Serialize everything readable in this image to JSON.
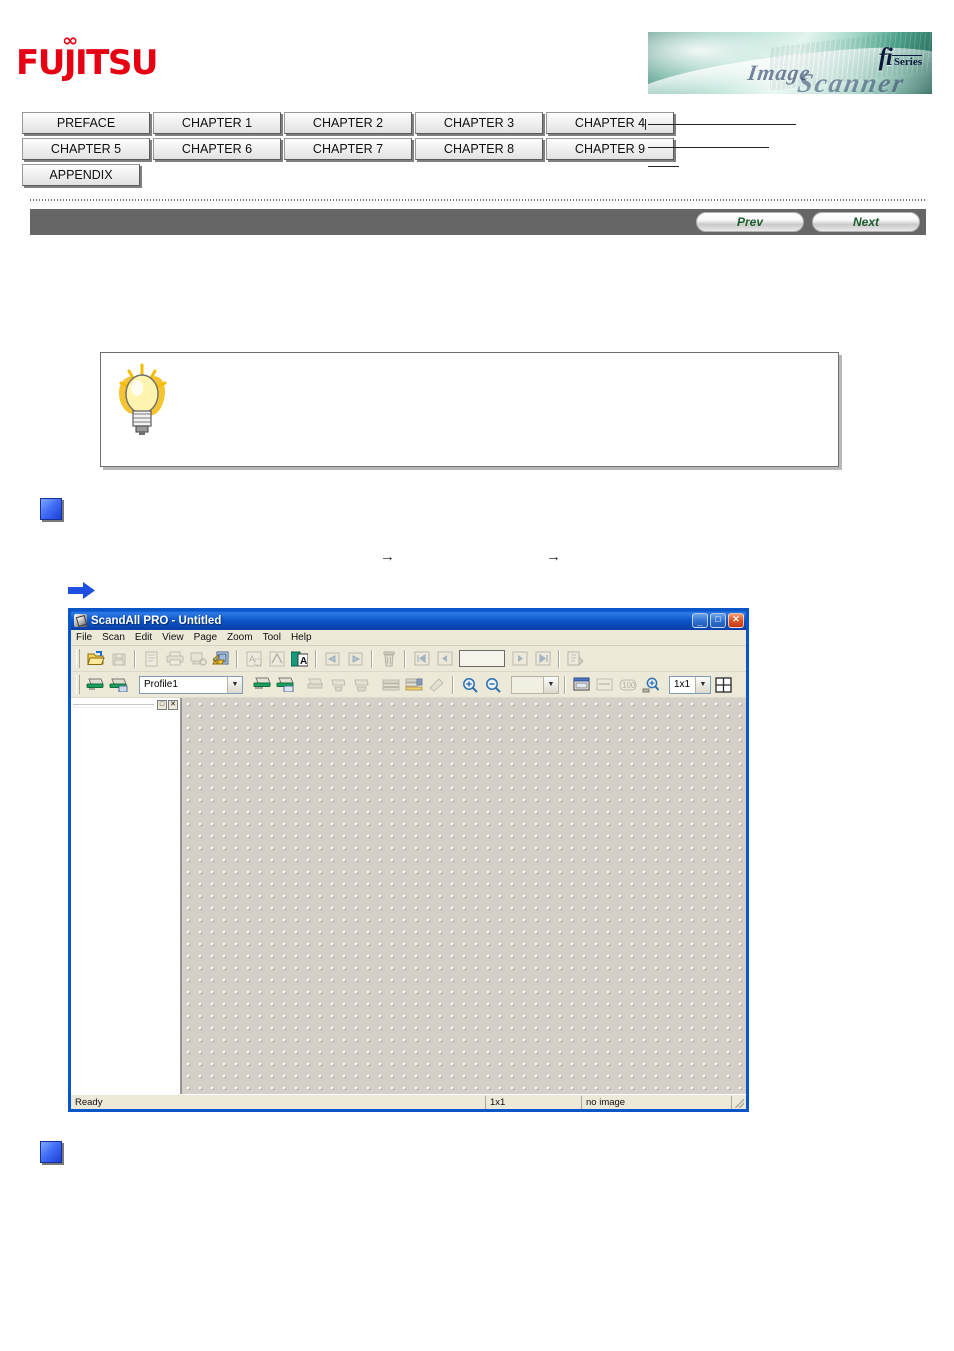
{
  "header": {
    "logo_text": "FUJITSU",
    "logo_infinity": "∞",
    "banner": {
      "fi_text": "fi",
      "series_text": "Series",
      "word1": "Image",
      "word2": "Scanner"
    }
  },
  "nav_tabs": {
    "row1": [
      {
        "label": "PREFACE"
      },
      {
        "label": "CHAPTER 1"
      },
      {
        "label": "CHAPTER 2"
      },
      {
        "label": "CHAPTER 3"
      },
      {
        "label": "CHAPTER 4"
      }
    ],
    "row2": [
      {
        "label": "CHAPTER 5"
      },
      {
        "label": "CHAPTER 6"
      },
      {
        "label": "CHAPTER 7"
      },
      {
        "label": "CHAPTER 8"
      },
      {
        "label": "CHAPTER 9"
      }
    ],
    "row3": [
      {
        "label": "APPENDIX"
      }
    ]
  },
  "pager": {
    "prev_label": "Prev",
    "next_label": "Next",
    "bar_color": "#666666",
    "label_color": "#1d5c2e"
  },
  "tip_box": {
    "icon": "lightbulb-icon",
    "body_text": ""
  },
  "body": {
    "arrow_glyph_1": "→",
    "arrow_glyph_2": "→",
    "bullet_color": "#3f6cf5"
  },
  "app_window": {
    "title": "ScandAll PRO - Untitled",
    "window_controls": {
      "minimize": "_",
      "maximize": "□",
      "close": "✕"
    },
    "menu": [
      {
        "label": "File",
        "accel": "F"
      },
      {
        "label": "Scan",
        "accel": "S"
      },
      {
        "label": "Edit",
        "accel": "E"
      },
      {
        "label": "View",
        "accel": "V"
      },
      {
        "label": "Page",
        "accel": "P"
      },
      {
        "label": "Zoom",
        "accel": "Z"
      },
      {
        "label": "Tool",
        "accel": "T"
      },
      {
        "label": "Help",
        "accel": "H"
      }
    ],
    "toolbar_row1": [
      {
        "name": "open-icon",
        "enabled": true
      },
      {
        "name": "save-icon",
        "enabled": false
      },
      {
        "name": "page-properties-icon",
        "enabled": false
      },
      {
        "name": "print-icon",
        "enabled": false
      },
      {
        "name": "print-preview-icon",
        "enabled": false
      },
      {
        "name": "export-icon",
        "enabled": true
      },
      {
        "name": "ocr-zone-icon",
        "enabled": false
      },
      {
        "name": "ocr-text-icon",
        "enabled": false
      },
      {
        "name": "ocr-apply-icon",
        "enabled": true
      },
      {
        "name": "rotate-left-icon",
        "enabled": false
      },
      {
        "name": "rotate-right-icon",
        "enabled": false
      },
      {
        "name": "delete-page-icon",
        "enabled": false
      },
      {
        "name": "first-page-icon",
        "enabled": false
      },
      {
        "name": "prev-page-icon",
        "enabled": false
      },
      {
        "name": "page-number-field",
        "enabled": false
      },
      {
        "name": "next-page-icon",
        "enabled": false
      },
      {
        "name": "last-page-icon",
        "enabled": false
      },
      {
        "name": "insert-page-icon",
        "enabled": false
      }
    ],
    "toolbar_row2": {
      "scan_icon": "scan-icon",
      "scan_batch_icon": "scan-batch-icon",
      "profile_value": "Profile1",
      "profile_options": [
        "Profile1"
      ],
      "icons_after_profile": [
        {
          "name": "scan-to-file-icon",
          "enabled": true
        },
        {
          "name": "scan-to-folder-icon",
          "enabled": true
        },
        {
          "name": "scan-settings-icon",
          "enabled": false
        },
        {
          "name": "batch-setup-icon",
          "enabled": false
        },
        {
          "name": "batch-edit-icon",
          "enabled": false
        },
        {
          "name": "imprinter-icon",
          "enabled": false
        },
        {
          "name": "separator-sheet-icon",
          "enabled": false
        },
        {
          "name": "cleanup-icon",
          "enabled": false
        }
      ],
      "zoom_in_icon": "zoom-in-icon",
      "zoom_out_icon": "zoom-out-icon",
      "blank_select_value": "",
      "view_icons": [
        {
          "name": "fit-window-icon",
          "enabled": true
        },
        {
          "name": "fit-width-icon",
          "enabled": false
        },
        {
          "name": "actual-size-icon",
          "enabled": false
        },
        {
          "name": "zoom-tool-icon",
          "enabled": true
        }
      ],
      "layout_value": "1x1",
      "layout_options": [
        "1x1"
      ],
      "grid_icon": "grid-layout-icon"
    },
    "left_panel": {
      "restore_btn": "□",
      "close_btn": "✕"
    },
    "status_bar": {
      "message": "Ready",
      "layout": "1x1",
      "image_state": "no image"
    }
  }
}
